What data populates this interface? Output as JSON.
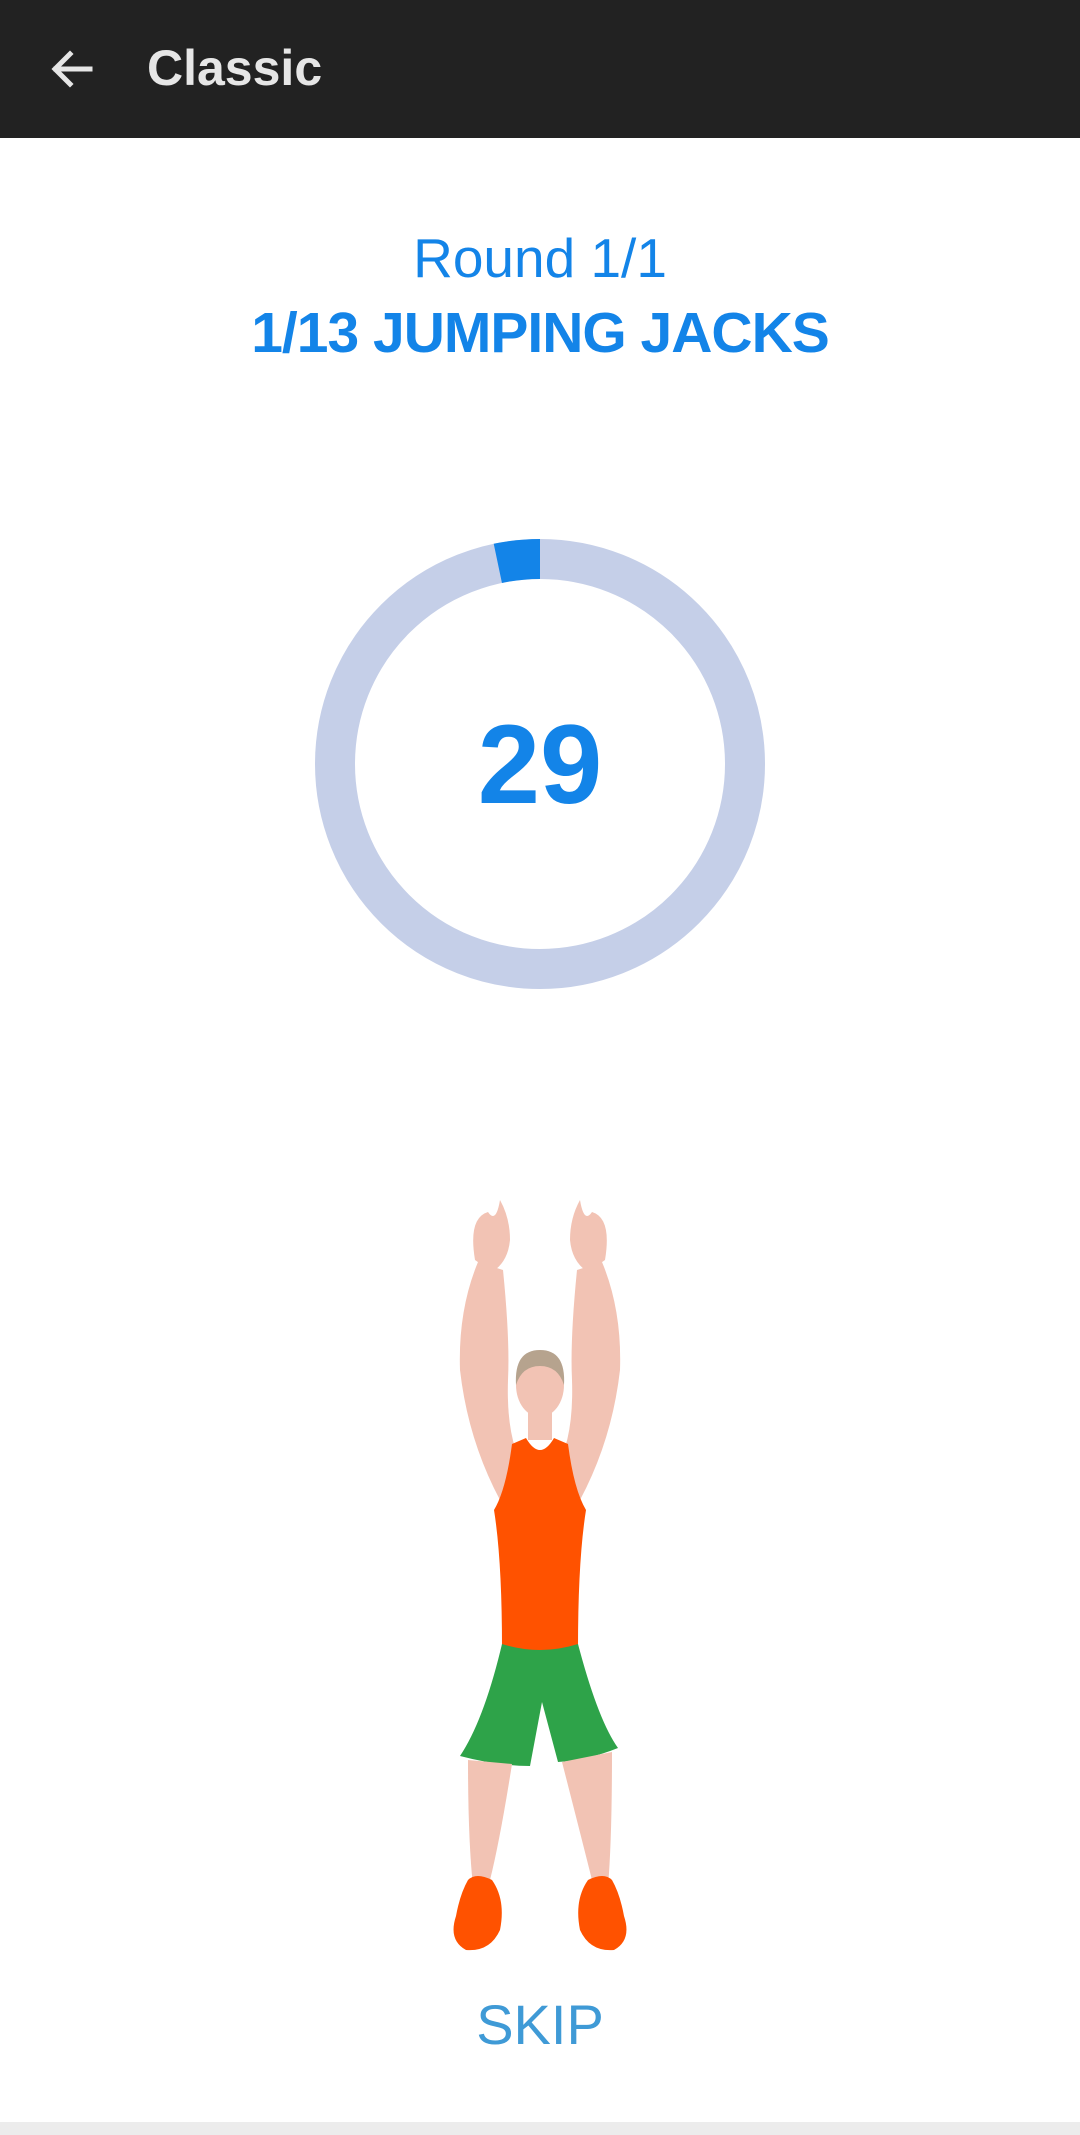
{
  "app_bar": {
    "title": "Classic",
    "back_icon": "arrow-left-icon"
  },
  "workout": {
    "round": "Round 1/1",
    "exercise": "1/13  JUMPING JACKS",
    "timer": {
      "value": "29",
      "progress_fraction": 0.033,
      "track_color": "#c5cfe8",
      "progress_color": "#1384e8"
    },
    "illustration": "jumping-jacks-figure"
  },
  "actions": {
    "skip_label": "SKIP"
  },
  "colors": {
    "accent": "#1384e8",
    "app_bar": "#222222"
  }
}
